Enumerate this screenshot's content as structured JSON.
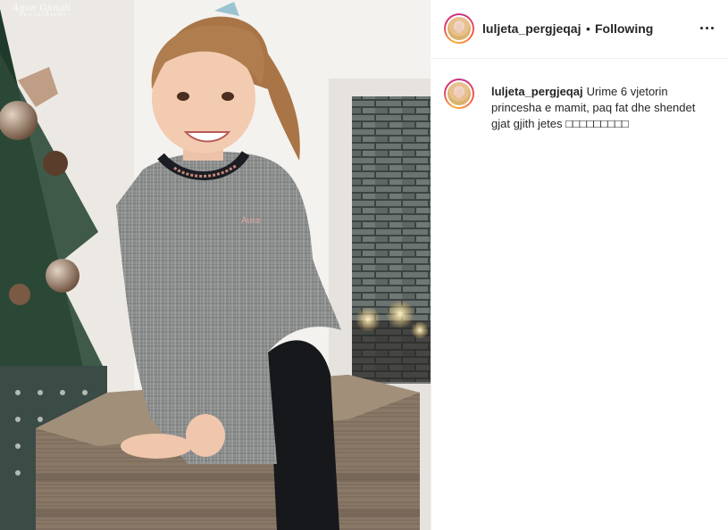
{
  "photo": {
    "credit_line1": "Agon Gjinali",
    "credit_line2": "PHOTOGRAPHY"
  },
  "post": {
    "username": "luljeta_pergjeqaj",
    "separator": "•",
    "follow_status": "Following",
    "more_icon": "more-horizontal-icon",
    "caption_username": "luljeta_pergjeqaj",
    "caption_text": "Urime 6 vjetorin princesha e mamit, paq fat dhe shendet gjat gjith jetes □□□□□□□□□"
  },
  "colors": {
    "story_ring_start": "#f9b233",
    "story_ring_end": "#c13584",
    "text": "#262626",
    "divider": "#efefef"
  }
}
